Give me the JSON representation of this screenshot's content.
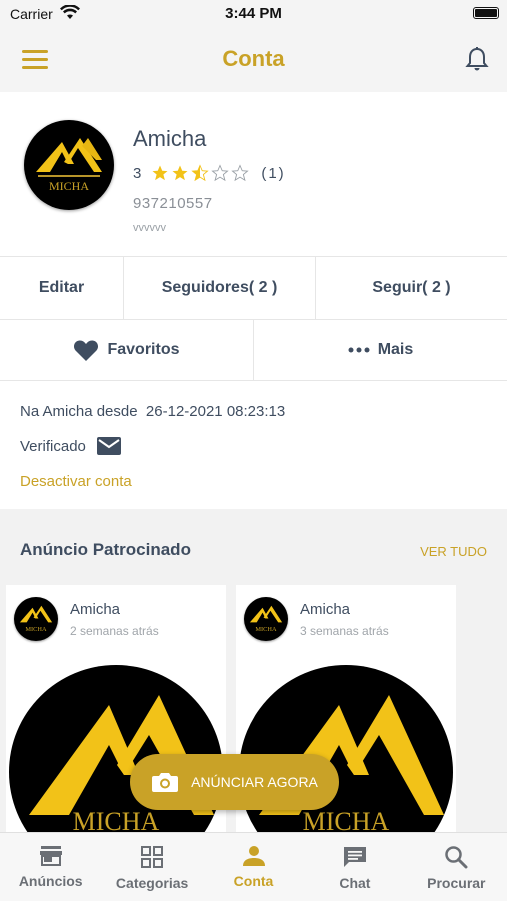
{
  "status": {
    "carrier": "Carrier",
    "time": "3:44 PM"
  },
  "nav": {
    "title": "Conta"
  },
  "profile": {
    "name": "Amicha",
    "rating_value": "3",
    "stars": 2.5,
    "rating_count": "(1)",
    "phone": "937210557",
    "description": "vvvvvv",
    "logo_text": "MICHA"
  },
  "actions": {
    "edit": "Editar",
    "followers": "Seguidores( 2 )",
    "following": "Seguir( 2 )",
    "favorites": "Favoritos",
    "more": "Mais"
  },
  "info": {
    "since_label": "Na Amicha desde",
    "since_date": "26-12-2021 08:23:13",
    "verified": "Verificado",
    "deactivate": "Desactivar conta"
  },
  "sponsored": {
    "title": "Anúncio Patrocinado",
    "see_all": "VER TUDO",
    "cards": [
      {
        "name": "Amicha",
        "time": "2 semanas atrás"
      },
      {
        "name": "Amicha",
        "time": "3 semanas atrás"
      }
    ]
  },
  "fab": {
    "label": "ANÚNCIAR AGORA"
  },
  "tabs": [
    {
      "label": "Anúncios",
      "icon": "store-icon"
    },
    {
      "label": "Categorias",
      "icon": "grid-icon"
    },
    {
      "label": "Conta",
      "icon": "person-icon"
    },
    {
      "label": "Chat",
      "icon": "chat-icon"
    },
    {
      "label": "Procurar",
      "icon": "search-icon"
    }
  ],
  "colors": {
    "accent": "#c9a227",
    "text": "#3f4d60",
    "background": "#f2f2f2"
  }
}
